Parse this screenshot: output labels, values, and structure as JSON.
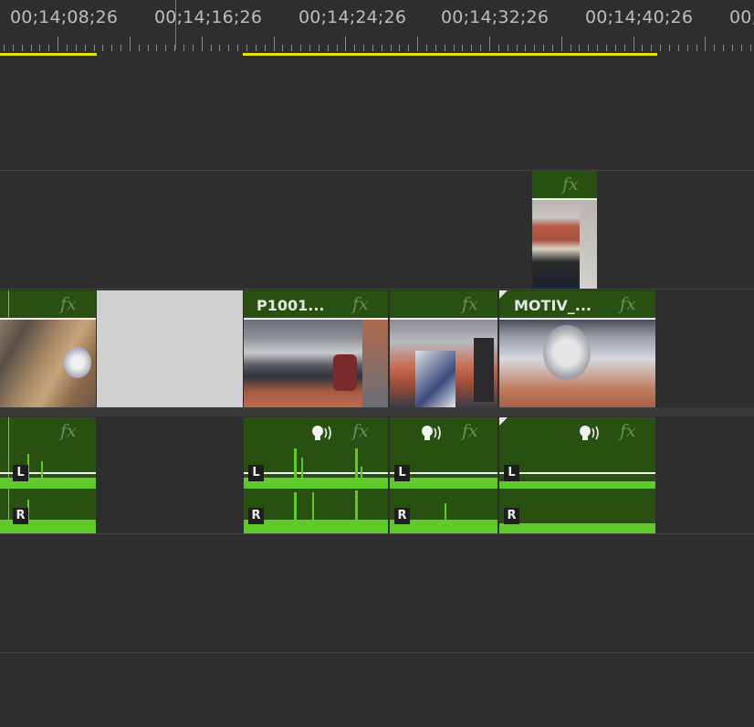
{
  "ruler": {
    "timecodes": [
      "00;14;08;26",
      "00;14;16;26",
      "00;14;24;26",
      "00;14;32;26",
      "00;14;40;26",
      "00;"
    ]
  },
  "colors": {
    "clip_green": "#285011",
    "waveform": "#5ecb2b",
    "in_out_bar": "#e8e000",
    "gap_fill": "#d0d0d0"
  },
  "video_clips": {
    "v2_clip": {
      "name": "",
      "fx": "fx"
    },
    "v1_clip_a": {
      "name": "",
      "fx": "fx"
    },
    "v1_clip_b": {
      "name": "P1001...",
      "fx": "fx"
    },
    "v1_clip_c": {
      "name": "",
      "fx": "fx"
    },
    "v1_clip_d": {
      "name": "MOTIV_...",
      "fx": "fx"
    }
  },
  "audio_clips": {
    "a1_clip_a": {
      "fx": "fx",
      "left": "L",
      "right": "R"
    },
    "a1_clip_b": {
      "fx": "fx",
      "left": "L",
      "right": "R",
      "icon": "speech-icon"
    },
    "a1_clip_c": {
      "fx": "fx",
      "left": "L",
      "right": "R",
      "icon": "speech-icon"
    },
    "a1_clip_d": {
      "fx": "fx",
      "left": "L",
      "right": "R",
      "icon": "speech-icon"
    }
  }
}
